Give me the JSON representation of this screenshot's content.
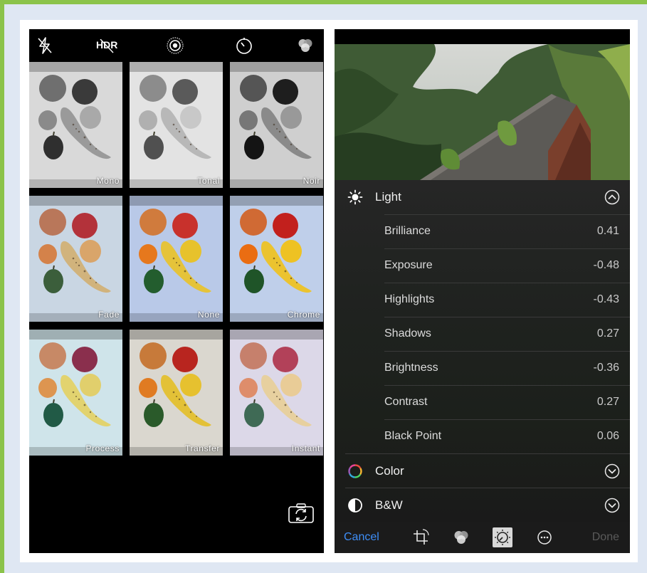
{
  "camera": {
    "hdr_label": "HDR",
    "icons": [
      "flash-off-icon",
      "hdr-icon",
      "live-photo-icon",
      "timer-icon",
      "filters-icon"
    ],
    "filters": [
      {
        "label": "Mono",
        "style": "mono"
      },
      {
        "label": "Tonal",
        "style": "tonal"
      },
      {
        "label": "Noir",
        "style": "noir"
      },
      {
        "label": "Fade",
        "style": "fade"
      },
      {
        "label": "None",
        "style": "none"
      },
      {
        "label": "Chrome",
        "style": "chrome"
      },
      {
        "label": "Process",
        "style": "process"
      },
      {
        "label": "Transfer",
        "style": "transfer"
      },
      {
        "label": "Instant",
        "style": "instant"
      }
    ]
  },
  "editor": {
    "light": {
      "label": "Light",
      "adjustments": [
        {
          "label": "Brilliance",
          "value": "0.41"
        },
        {
          "label": "Exposure",
          "value": "-0.48"
        },
        {
          "label": "Highlights",
          "value": "-0.43"
        },
        {
          "label": "Shadows",
          "value": "0.27"
        },
        {
          "label": "Brightness",
          "value": "-0.36"
        },
        {
          "label": "Contrast",
          "value": "0.27"
        },
        {
          "label": "Black Point",
          "value": "0.06"
        }
      ]
    },
    "color_label": "Color",
    "bw_label": "B&W",
    "toolbar": {
      "cancel": "Cancel",
      "done": "Done"
    }
  },
  "colors": {
    "accent": "#3e8ef7",
    "frame": "#8bc34a",
    "background": "#dfe7f3"
  }
}
